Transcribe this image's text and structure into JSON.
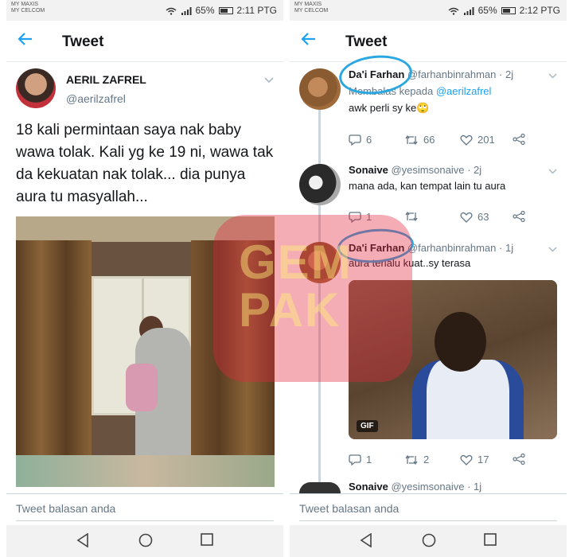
{
  "left": {
    "status": {
      "carrier1": "MY MAXIS",
      "carrier2": "MY CELCOM",
      "battery": "65%",
      "time": "2:11 PTG"
    },
    "title": "Tweet",
    "tweet": {
      "name": "AERIL ZAFREL",
      "handle": "@aerilzafrel",
      "text": "18 kali permintaan saya nak baby wawa tolak. Kali yg ke 19 ni, wawa tak da kekuatan nak tolak... dia punya aura tu masyallah..."
    },
    "reply_placeholder": "Tweet balasan anda"
  },
  "right": {
    "status": {
      "carrier1": "MY MAXIS",
      "carrier2": "MY CELCOM",
      "battery": "65%",
      "time": "2:12 PTG"
    },
    "title": "Tweet",
    "replies": [
      {
        "name": "Da'i Farhan",
        "handle": "@farhanbinrahman",
        "time": "2j",
        "reply_prefix": "Membalas kepada",
        "reply_to": "@aerilzafrel",
        "text": "awk perli sy ke🙄",
        "counts": {
          "replies": "6",
          "retweets": "66",
          "likes": "201"
        }
      },
      {
        "name": "Sonaive",
        "handle": "@yesimsonaive",
        "time": "2j",
        "text": "mana ada, kan tempat lain tu aura",
        "counts": {
          "replies": "1",
          "retweets": "",
          "likes": "63"
        }
      },
      {
        "name": "Da'i Farhan",
        "handle": "@farhanbinrahman",
        "time": "1j",
        "text": "aura terlalu kuat..sy terasa",
        "gif_label": "GIF",
        "counts": {
          "replies": "1",
          "retweets": "2",
          "likes": "17"
        }
      }
    ],
    "partial_row": {
      "name": "Sonaive",
      "handle": "@yesimsonaive",
      "time": "1j"
    },
    "reply_placeholder": "Tweet balasan anda"
  },
  "watermark": {
    "line1": "GEM",
    "line2": "PAK"
  },
  "colors": {
    "accent": "#1da1f2",
    "muted": "#657786",
    "annotation": "#2aa7e0",
    "watermark": "#e6283c"
  },
  "icons": [
    "back-arrow-icon",
    "chevron-down-icon",
    "reply-icon",
    "retweet-icon",
    "like-icon",
    "share-icon",
    "nav-back-icon",
    "nav-home-icon",
    "nav-recents-icon",
    "wifi-icon",
    "signal-icon",
    "battery-icon"
  ]
}
